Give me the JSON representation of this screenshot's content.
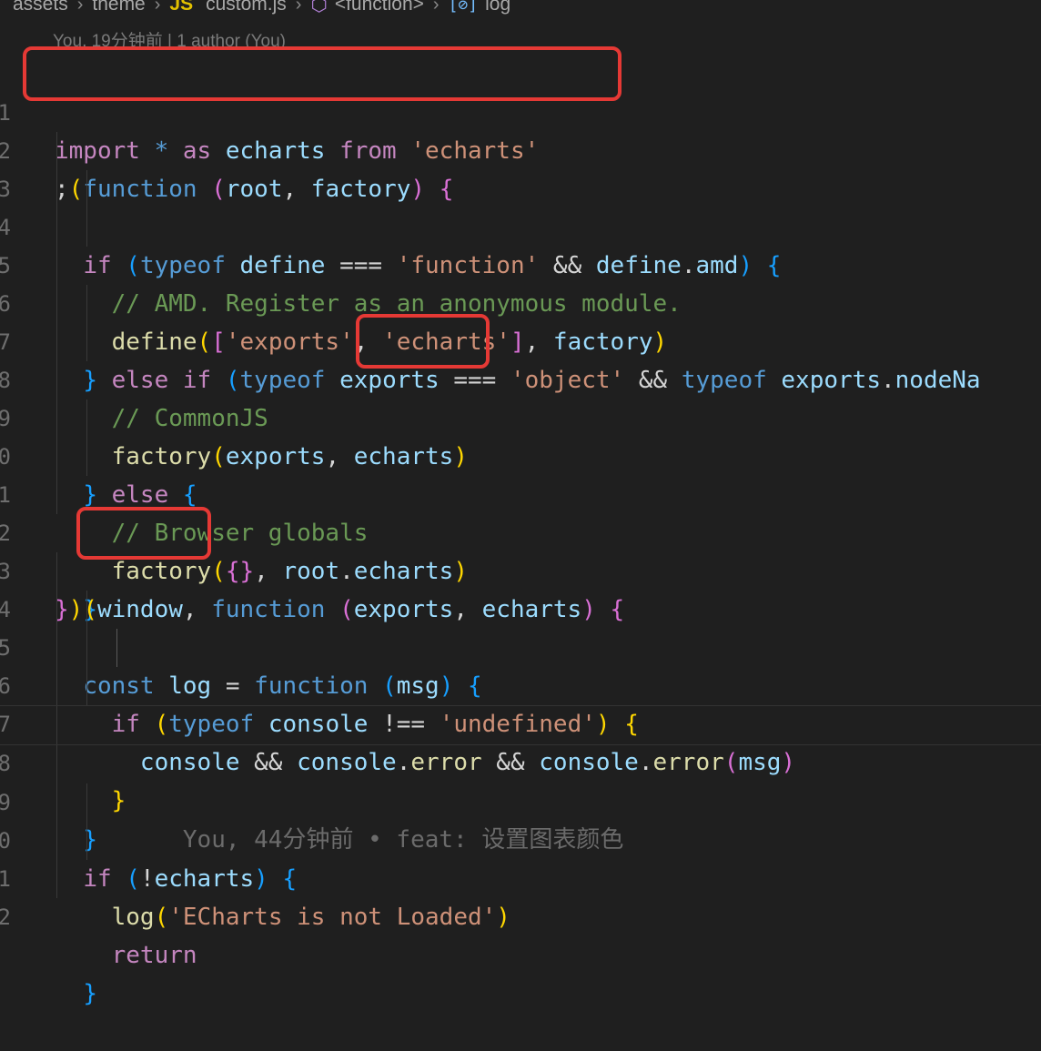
{
  "breadcrumb": {
    "folder1": "assets",
    "folder2": "theme",
    "file_icon": "JS",
    "file": "custom.js",
    "symbol1": "<function>",
    "symbol2": "log"
  },
  "blame_header": "You, 19分钟前 | 1 author (You)",
  "inline_blame": "You, 44分钟前 • feat: 设置图表颜色",
  "line_numbers": [
    "1",
    "2",
    "3",
    "4",
    "5",
    "6",
    "7",
    "8",
    "9",
    "0",
    "1",
    "2",
    "3",
    "4",
    "5",
    "6",
    "7",
    "8",
    "9",
    "0",
    "1",
    "2"
  ],
  "tokens": {
    "import": "import",
    "star": "*",
    "as": "as",
    "echarts": "echarts",
    "from": "from",
    "str_echarts": "'echarts'",
    "function": "function",
    "root": "root",
    "factory": "factory",
    "if": "if",
    "typeof": "typeof",
    "define": "define",
    "str_function": "'function'",
    "amd": "amd",
    "cm_amd": "// AMD. Register as an anonymous module.",
    "str_exports": "'exports'",
    "else": "else",
    "exports": "exports",
    "str_object": "'object'",
    "nodeNa": "nodeNa",
    "cm_common": "// CommonJS",
    "cm_browser": "// Browser globals",
    "window": "window",
    "const": "const",
    "log": "log",
    "msg": "msg",
    "console": "console",
    "str_undefined": "'undefined'",
    "error": "error",
    "str_loaded": "'ECharts is not Loaded'",
    "return": "return"
  },
  "colors": {
    "highlight_box": "#e53935",
    "background": "#1f1f1f"
  }
}
